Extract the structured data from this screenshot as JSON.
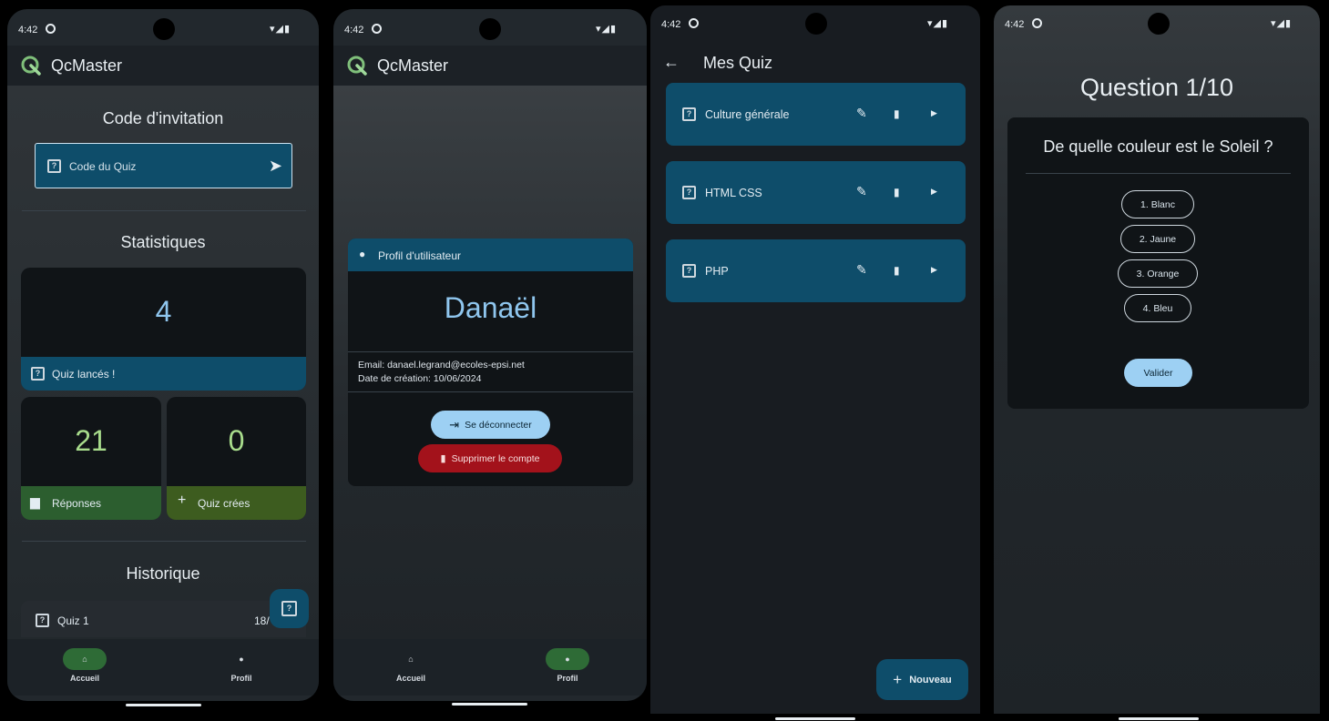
{
  "colors": {
    "background": "#ffffff",
    "surface_dark": "#181c21",
    "card_dark": "#101417",
    "accent_blue": "#0e4d6a",
    "accent_green": "#2c5e2f",
    "accent_olive": "#3d5c1f",
    "number_blue": "#8fc6ee",
    "number_green": "#a8dc8c",
    "danger_red": "#a3121b",
    "pill_blue": "#9dd0f3"
  },
  "status": {
    "time": "4:42"
  },
  "screen1": {
    "app_title": "QcMaster",
    "invite_heading": "Code d'invitation",
    "invite_placeholder": "Code du Quiz",
    "stats_heading": "Statistiques",
    "quiz_launched_count": "4",
    "quiz_launched_label": "Quiz lancés !",
    "answers_count": "21",
    "answers_label": "Réponses",
    "created_count": "0",
    "created_label": "Quiz crées",
    "history_heading": "Historique",
    "history_item_label": "Quiz 1",
    "history_item_date": "18/",
    "nav": {
      "home": "Accueil",
      "profile": "Profil"
    }
  },
  "screen2": {
    "app_title": "QcMaster",
    "profile_header": "Profil d'utilisateur",
    "user_name": "Danaël",
    "email_line": "Email: danael.legrand@ecoles-epsi.net",
    "created_line": "Date de création: 10/06/2024",
    "logout_label": "Se déconnecter",
    "delete_label": "Supprimer le compte",
    "nav": {
      "home": "Accueil",
      "profile": "Profil"
    }
  },
  "screen3": {
    "title": "Mes Quiz",
    "quizzes": [
      {
        "label": "Culture générale"
      },
      {
        "label": "HTML CSS"
      },
      {
        "label": "PHP"
      }
    ],
    "new_label": "Nouveau"
  },
  "screen4": {
    "question_counter": "Question 1/10",
    "question_text": "De quelle couleur est le Soleil ?",
    "options": [
      "1. Blanc",
      "2. Jaune",
      "3. Orange",
      "4. Bleu"
    ],
    "validate_label": "Valider"
  }
}
